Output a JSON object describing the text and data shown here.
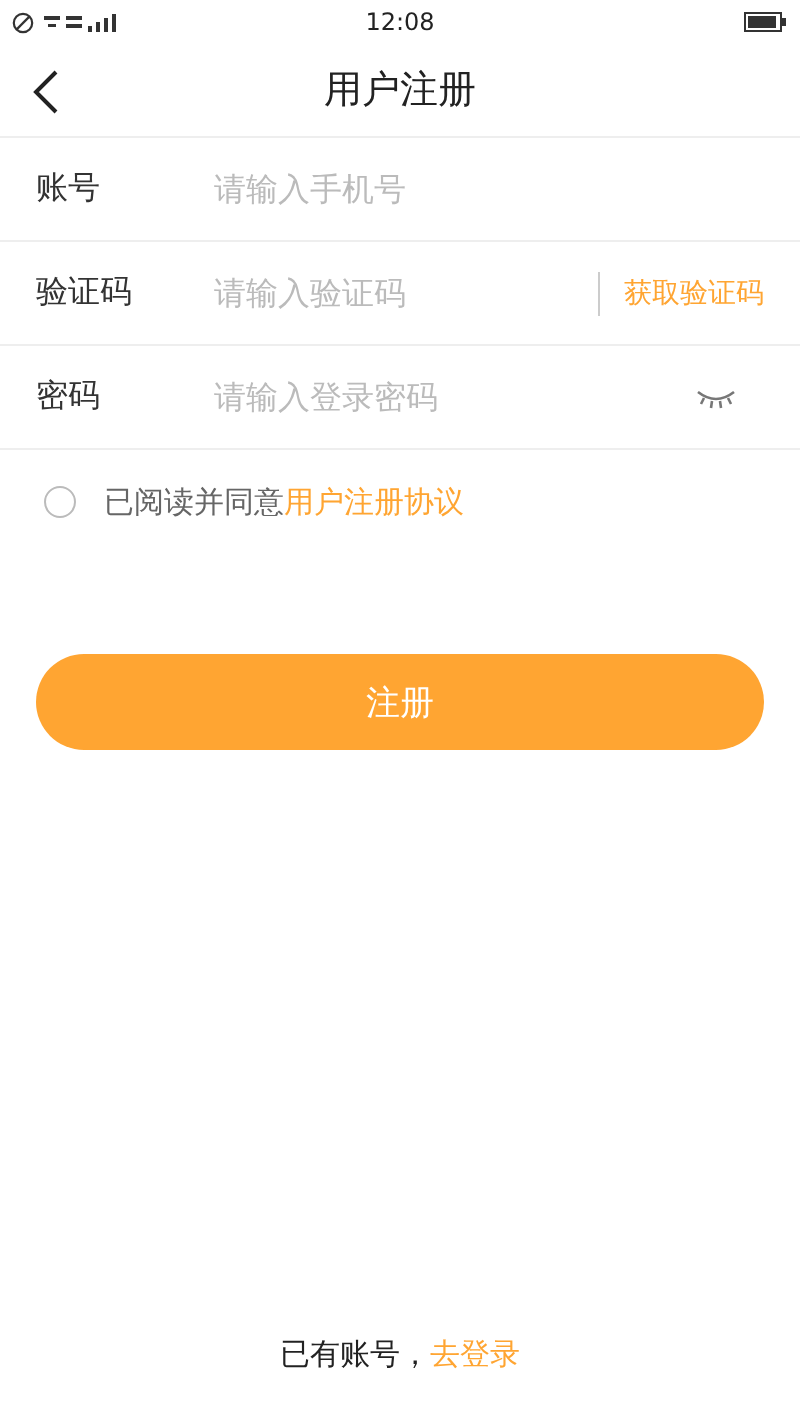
{
  "status_bar": {
    "time": "12:08"
  },
  "header": {
    "title": "用户注册"
  },
  "fields": [
    {
      "kind": "text",
      "label": "账号",
      "placeholder": "请输入手机号"
    },
    {
      "kind": "code",
      "label": "验证码",
      "placeholder": "请输入验证码",
      "action": "获取验证码"
    },
    {
      "kind": "password",
      "label": "密码",
      "placeholder": "请输入登录密码",
      "visible": false
    }
  ],
  "agreement": {
    "checked": false,
    "text": "已阅读并同意",
    "link": "用户注册协议"
  },
  "submit": "注册",
  "footer": {
    "text": "已有账号，",
    "link": "去登录"
  }
}
